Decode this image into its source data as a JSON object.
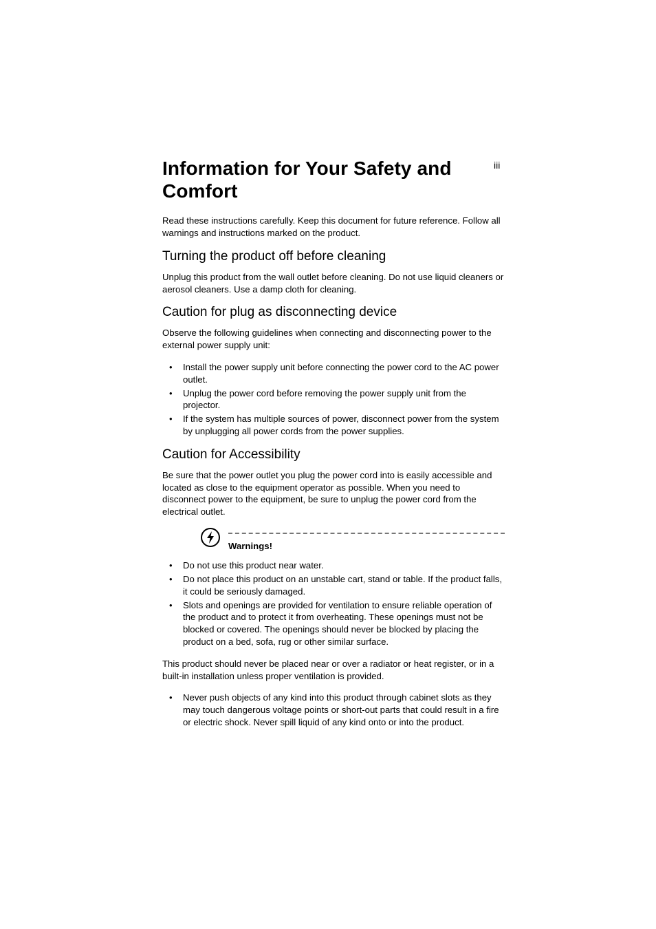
{
  "page_number": "iii",
  "title": "Information for Your Safety and Comfort",
  "intro": "Read these instructions carefully. Keep this document for future reference. Follow all warnings and instructions marked on the product.",
  "section1": {
    "heading": "Turning the product off before cleaning",
    "body": "Unplug this product from the wall outlet before cleaning. Do not use liquid cleaners or aerosol cleaners. Use a damp cloth for cleaning."
  },
  "section2": {
    "heading": "Caution for plug as disconnecting device",
    "body": "Observe the following guidelines when connecting and disconnecting power to the external power supply unit:",
    "items": [
      "Install the power supply unit before connecting the power cord to the AC power outlet.",
      "Unplug the power cord before removing the power supply unit from the projector.",
      "If the system has multiple sources of power, disconnect power from the system by unplugging all power cords from the power supplies."
    ]
  },
  "section3": {
    "heading": "Caution for Accessibility",
    "body": "Be sure that the power outlet you plug the power cord into is easily accessible and located as close to the equipment operator as possible. When you need to disconnect power to the equipment, be sure to unplug the power cord from the electrical outlet."
  },
  "warnings": {
    "label": "Warnings!",
    "items1": [
      "Do not use this product near water.",
      "Do not place this product on an unstable cart, stand or table. If the product falls, it could be seriously damaged.",
      "Slots and openings are provided for ventilation to ensure reliable operation of the product and to protect it from overheating. These openings must not be blocked or covered. The openings should never be blocked by placing the product on a bed, sofa, rug or other similar surface."
    ],
    "mid": "This product should never be placed near or over a radiator or heat register, or in a built-in installation unless proper ventilation is provided.",
    "items2": [
      "Never push objects of any kind into this product through cabinet slots as they may touch dangerous voltage points or short-out parts that could result in a fire or electric shock. Never spill liquid of any kind onto or into the product."
    ]
  }
}
